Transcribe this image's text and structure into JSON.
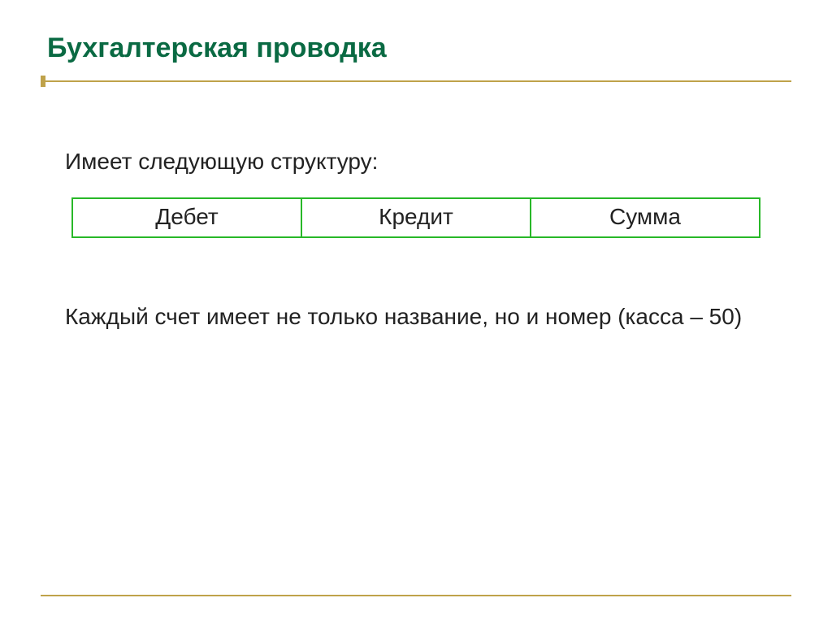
{
  "title": "Бухгалтерская проводка",
  "intro": "Имеет следующую структуру:",
  "columns": {
    "debit": "Дебет",
    "credit": "Кредит",
    "sum": "Сумма"
  },
  "note": "Каждый счет имеет не только название, но  и номер (касса – 50)"
}
